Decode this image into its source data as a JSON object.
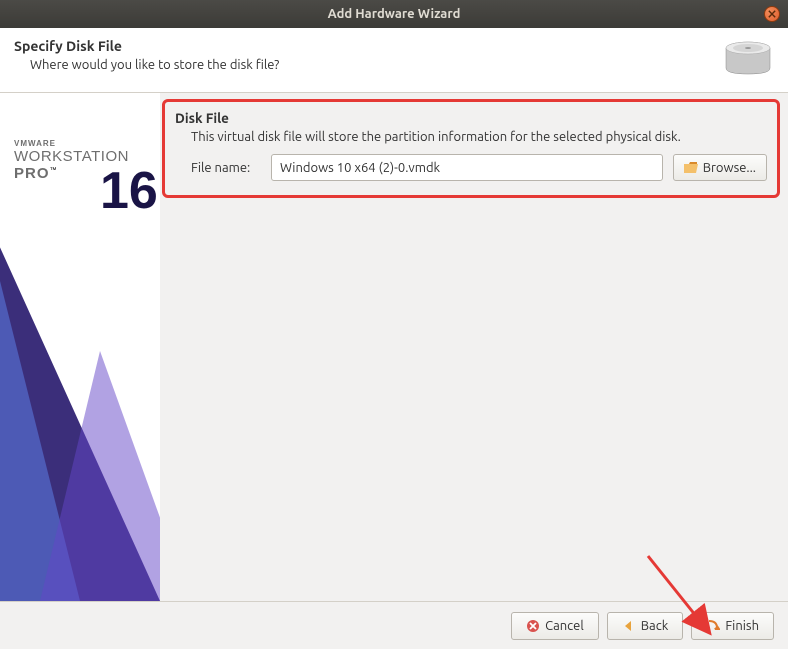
{
  "titlebar": {
    "title": "Add Hardware Wizard"
  },
  "header": {
    "title": "Specify Disk File",
    "subtitle": "Where would you like to store the disk file?"
  },
  "sidebar": {
    "brand": "VMWARE",
    "product": "WORKSTATION",
    "edition": "PRO",
    "version": "16"
  },
  "disk_file": {
    "section_title": "Disk File",
    "description": "This virtual disk file will store the partition information for the selected physical disk.",
    "file_label": "File name:",
    "file_value": "Windows 10 x64 (2)-0.vmdk",
    "browse_label": "Browse..."
  },
  "buttons": {
    "cancel": "Cancel",
    "back": "Back",
    "finish": "Finish"
  }
}
